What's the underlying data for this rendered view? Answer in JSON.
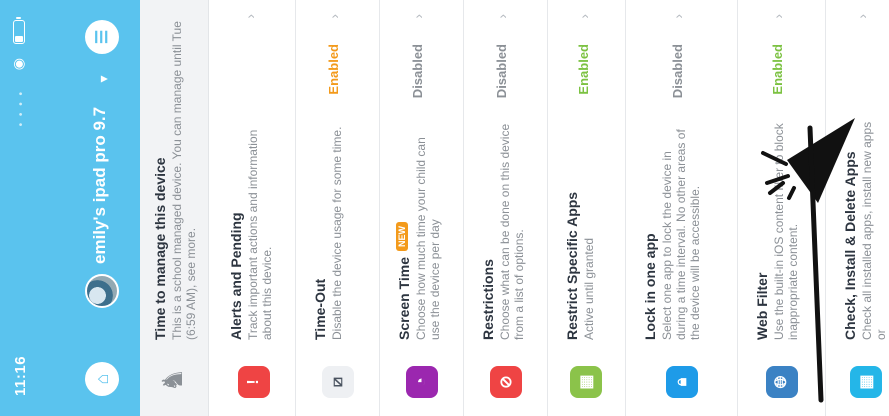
{
  "status_bar": {
    "time": "11:16"
  },
  "device": {
    "name": "emily's ipad pro 9.7"
  },
  "banner": {
    "title": "Time to manage this device",
    "text": "This is a school managed device. You can manage until Tue (6:59 AM), see more."
  },
  "rows": [
    {
      "title": "Alerts and Pending",
      "desc": "Track important actions and information about this device.",
      "status": "",
      "icon": "alert-icon",
      "icon_bg": "#ef4444"
    },
    {
      "title": "Time-Out",
      "desc": "Disable the device usage for some time.",
      "status": "Enabled",
      "icon": "timeout-icon",
      "icon_bg": "#eef0f3"
    },
    {
      "title": "Screen Time",
      "badge": "NEW",
      "desc": "Choose how much time your child can use the device per day",
      "status": "Disabled",
      "icon": "screen-time-icon",
      "icon_bg": "#9b27af"
    },
    {
      "title": "Restrictions",
      "desc": "Choose what can be done on this device from a list of options.",
      "status": "Disabled",
      "icon": "restrictions-icon",
      "icon_bg": "#ef4444"
    },
    {
      "title": "Restrict Specific Apps",
      "desc": "Active until granted",
      "status": "Enabled",
      "icon": "apps-grid-icon",
      "icon_bg": "#8bc34a"
    },
    {
      "title": "Lock in one app",
      "desc": "Select one app to lock the device in during a time interval. No other areas of the device will be accessible.",
      "status": "Disabled",
      "icon": "lock-app-icon",
      "icon_bg": "#1e9be8"
    },
    {
      "title": "Web Filter",
      "desc": "Use the built-in iOS content filter to block inappropriate content.",
      "status": "Enabled",
      "icon": "web-filter-icon",
      "icon_bg": "#3b82c4"
    },
    {
      "title": "Check, Install & Delete Apps",
      "desc": "Check all installed apps, install new apps or",
      "status": "",
      "icon": "install-apps-icon",
      "icon_bg": "#24b6e8"
    }
  ],
  "colors": {
    "accent": "#5ac3ee",
    "enabled": "#7cc242",
    "disabled": "#8b9096",
    "enabled_orange": "#f39a1b"
  }
}
